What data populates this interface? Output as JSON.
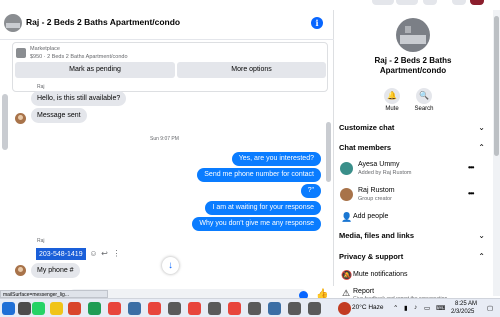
{
  "chat": {
    "title": "Raj - 2 Beds 2 Baths Apartment/condo",
    "marketplace_label": "Marketplace",
    "listing_subtitle": "$950 · 2 Beds 2 Baths Apartment/condo",
    "mark_pending_label": "Mark as pending",
    "more_options_label": "More options",
    "messages": {
      "sender_1": "Raj",
      "in_1": "Hello, is this still available?",
      "in_2": "Message sent",
      "timestamp": "Sun 9:07 PM",
      "out_1": "Yes, are you interested?",
      "out_2": "Send me phone number for contact",
      "out_3": "?\"",
      "out_4": "I am at waiting for your response",
      "out_5": "Why you don't give me any response",
      "sender_2": "Raj",
      "phone": "203-548-1419",
      "in_3": "My phone #"
    },
    "composer_placeholder": "Aa",
    "status_bar_text": "mailSurface=messenger_lig..."
  },
  "details": {
    "title_line1": "Raj - 2 Beds 2 Baths",
    "title_line2": "Apartment/condo",
    "mute_label": "Mute",
    "search_label": "Search",
    "customize_chat": "Customize chat",
    "chat_members": "Chat members",
    "members": [
      {
        "name": "Ayesa Ummy",
        "sub": "Added by Raj Rustom"
      },
      {
        "name": "Raj Rustom",
        "sub": "Group creator"
      }
    ],
    "add_people": "Add people",
    "media_files_links": "Media, files and links",
    "privacy_support": "Privacy & support",
    "mute_notifications": "Mute notifications",
    "report": "Report",
    "report_sub": "Give feedback and report the conversation"
  },
  "taskbar": {
    "weather": "20°C Haze",
    "time": "8:25 AM",
    "date": "2/3/2025"
  },
  "colors": {
    "accent": "#0866ff",
    "outgoing_bubble": "#0a7cff",
    "incoming_bubble": "#e4e6eb"
  }
}
